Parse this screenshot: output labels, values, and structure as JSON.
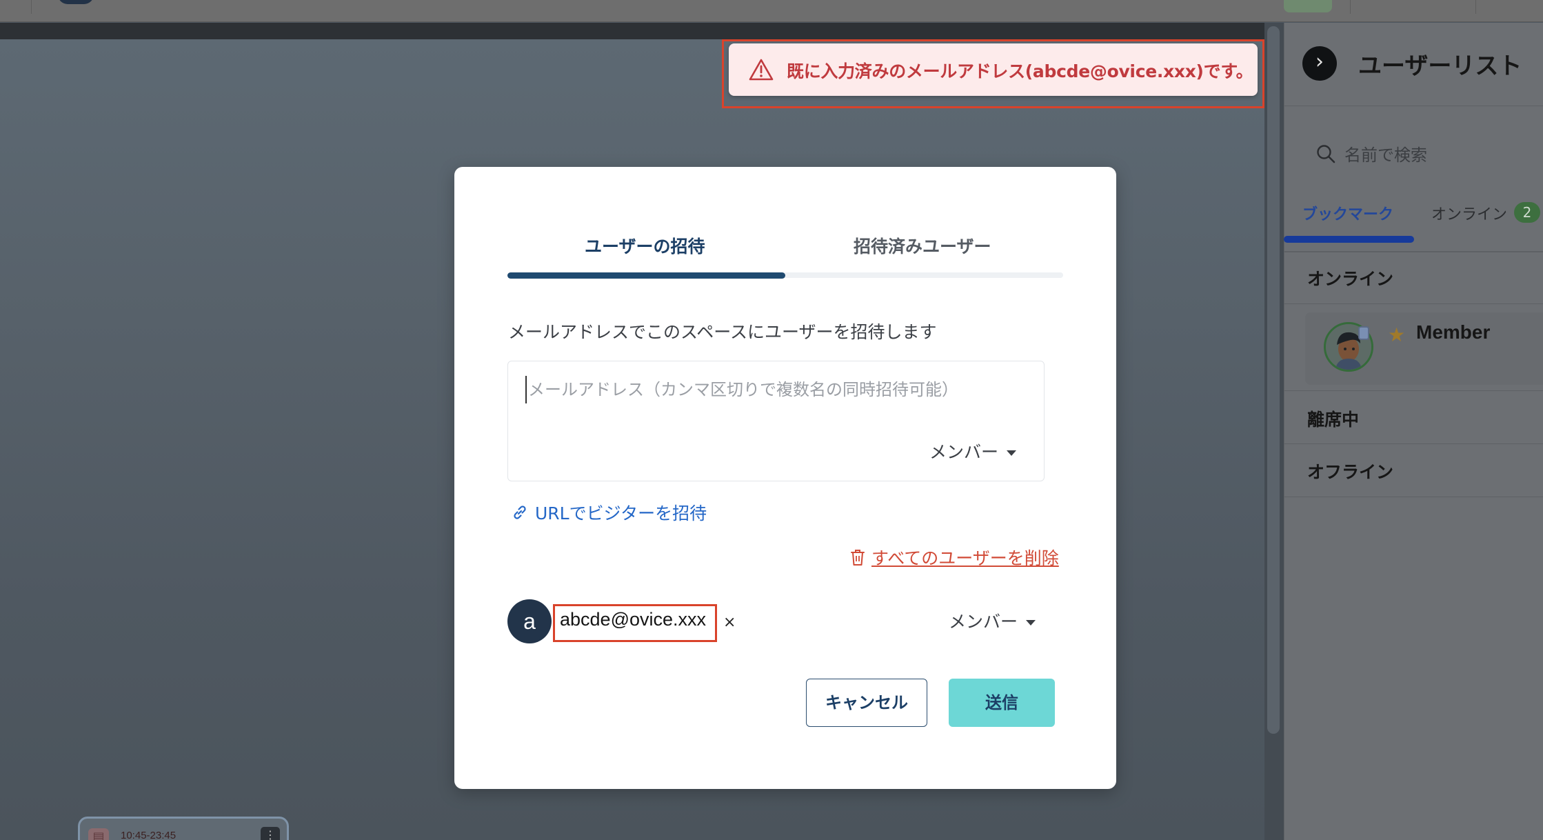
{
  "toast": {
    "message": "既に入力済みのメールアドレス(abcde@ovice.xxx)です。"
  },
  "modal": {
    "tabs": [
      {
        "label": "ユーザーの招待",
        "active": true
      },
      {
        "label": "招待済みユーザー",
        "active": false
      }
    ],
    "description": "メールアドレスでこのスペースにユーザーを招待します",
    "email_input": {
      "placeholder": "メールアドレス（カンマ区切りで複数名の同時招待可能）",
      "value": ""
    },
    "role_select": "メンバー",
    "invite_url_link": "URLでビジターを招待",
    "delete_all_link": "すべてのユーザーを削除",
    "invitees": [
      {
        "initial": "a",
        "email": "abcde@ovice.xxx",
        "remove": "×",
        "role": "メンバー"
      }
    ],
    "cancel_label": "キャンセル",
    "submit_label": "送信"
  },
  "user_panel": {
    "collapse_glyph": "›",
    "title": "ユーザーリスト",
    "search_placeholder": "名前で検索",
    "tabs": [
      {
        "label": "ブックマーク",
        "active": true
      },
      {
        "label": "オンライン",
        "badge": "2",
        "active": false
      }
    ],
    "sections": {
      "online": "オンライン",
      "away": "離席中",
      "offline": "オフライン"
    },
    "online_users": [
      {
        "name": "Member",
        "bookmarked": true,
        "icon": "star-icon"
      }
    ]
  },
  "schedule_card": {
    "time": "10:45-23:45",
    "menu_glyph": "⋮",
    "icon": "calendar-icon"
  },
  "colors": {
    "accent_navy": "#1f4a70",
    "submit_teal": "#6dd7d6",
    "error_red": "#c03a3e",
    "link_blue": "#2467c7",
    "delete_red": "#d14a36",
    "highlight": "#d9432b"
  }
}
